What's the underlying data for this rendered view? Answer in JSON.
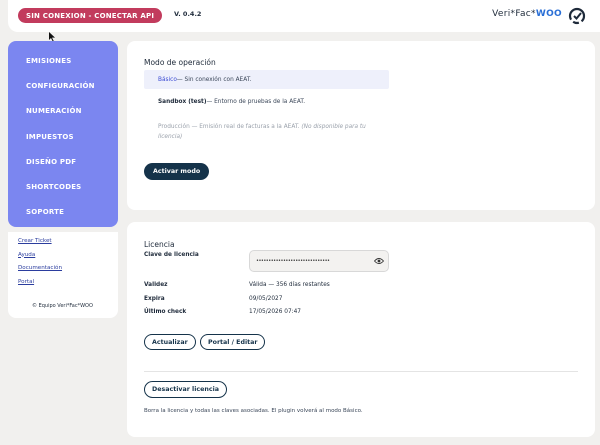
{
  "header": {
    "status_badge": "SIN CONEXION - CONECTAR API",
    "version": "V. 0.4.2",
    "brand_main": "Veri*Fac*",
    "brand_suffix": "WOO",
    "colors": {
      "badge": "#c23b5d",
      "brand_accent": "#2a6fd6"
    }
  },
  "sidebar": {
    "items": [
      {
        "label": "EMISIONES"
      },
      {
        "label": "CONFIGURACIÓN"
      },
      {
        "label": "NUMERACIÓN"
      },
      {
        "label": "IMPUESTOS"
      },
      {
        "label": "DISEÑO PDF"
      },
      {
        "label": "SHORTCODES"
      },
      {
        "label": "SOPORTE"
      }
    ],
    "links": [
      {
        "label": "Crear Ticket"
      },
      {
        "label": "Ayuda"
      },
      {
        "label": "Documentación"
      },
      {
        "label": "Portal"
      }
    ],
    "copyright": "© Equipo Veri*Fac*WOO",
    "color": "#7b86f0"
  },
  "mode": {
    "title": "Modo de operación",
    "options": [
      {
        "name": "Básico",
        "desc": " — Sin conexión con AEAT.",
        "selected": true
      },
      {
        "name": "Sandbox (test)",
        "desc": " — Entorno de pruebas de la AEAT.",
        "selected": false
      },
      {
        "name": "Producción",
        "desc": " — Emisión real de facturas a la AEAT. ",
        "note": "(No disponible para tu licencia)",
        "disabled": true
      }
    ],
    "activate_button": "Activar modo"
  },
  "license": {
    "title": "Licencia",
    "key_label": "Clave de licencia",
    "key_value": "••••••••••••••••••••••••••••••",
    "rows": [
      {
        "label": "Validez",
        "value": "Válida — 356 días restantes"
      },
      {
        "label": "Expira",
        "value": "09/05/2027"
      },
      {
        "label": "Último check",
        "value": "17/05/2026 07:47"
      }
    ],
    "update_button": "Actualizar",
    "portal_button": "Portal / Editar",
    "deactivate_button": "Desactivar licencia",
    "deactivate_note": "Borra la licencia y todas las claves asociadas. El plugin volverá al modo Básico."
  }
}
